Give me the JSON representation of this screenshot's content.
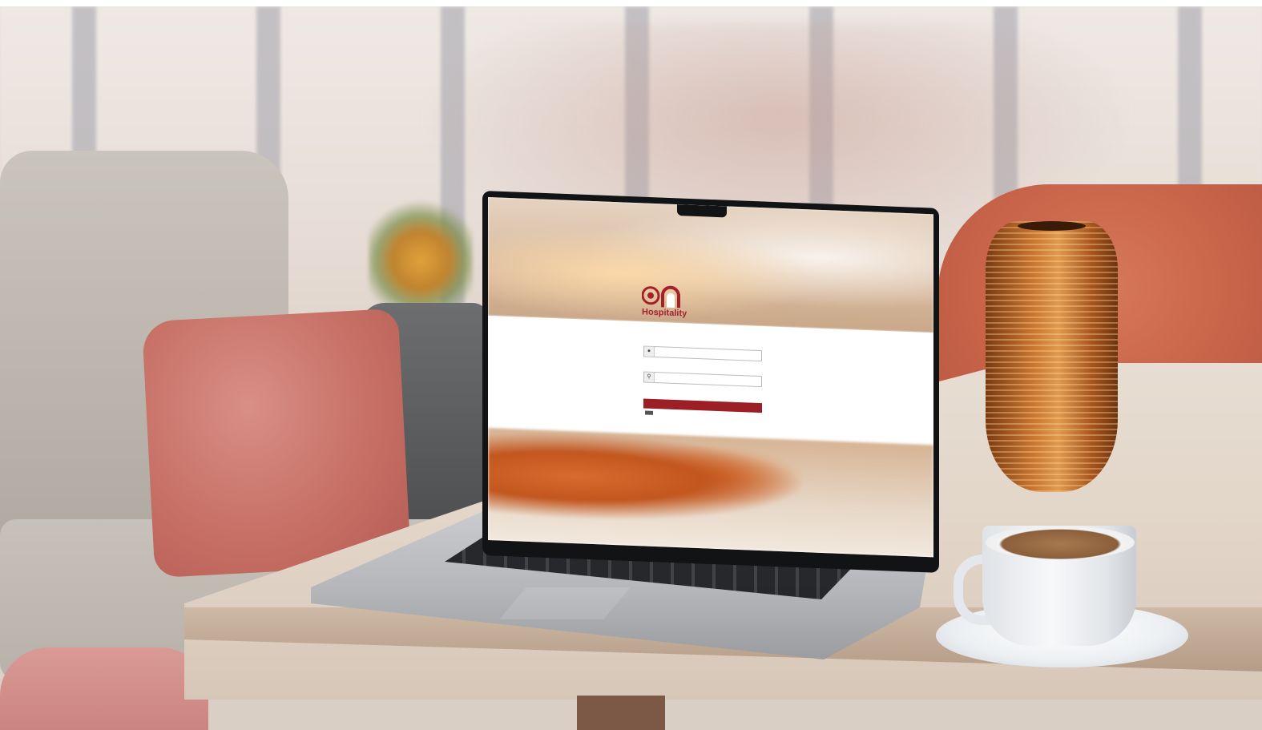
{
  "app": {
    "brand_name": "Hospitality",
    "brand_tagline": "",
    "accent_color": "#a3212c",
    "button_color": "#9c1f25"
  },
  "login": {
    "username_label": "",
    "username_placeholder": "",
    "username_icon": "user-icon",
    "password_label": "",
    "password_placeholder": "",
    "password_icon": "key-icon",
    "login_button_label": "",
    "language_selector": ""
  },
  "footer": {
    "links_line": "",
    "copyright_line": ""
  }
}
